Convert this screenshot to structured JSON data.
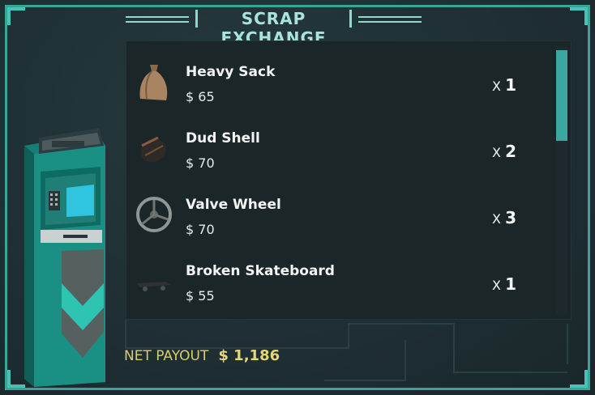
{
  "title": "SCRAP EXCHANGE",
  "items": [
    {
      "name": "Heavy Sack",
      "price": "$ 65",
      "qty_prefix": "X",
      "qty": "1",
      "icon": "sack-icon"
    },
    {
      "name": "Dud Shell",
      "price": "$ 70",
      "qty_prefix": "X",
      "qty": "2",
      "icon": "shell-icon"
    },
    {
      "name": "Valve Wheel",
      "price": "$ 70",
      "qty_prefix": "X",
      "qty": "3",
      "icon": "valve-wheel-icon"
    },
    {
      "name": "Broken Skateboard",
      "price": "$ 55",
      "qty_prefix": "X",
      "qty": "1",
      "icon": "skateboard-icon"
    }
  ],
  "payout": {
    "label": "NET PAYOUT",
    "value": "$ 1,186"
  },
  "colors": {
    "accent": "#3aa39a",
    "gold": "#e5d775",
    "panel": "#1b2628"
  }
}
